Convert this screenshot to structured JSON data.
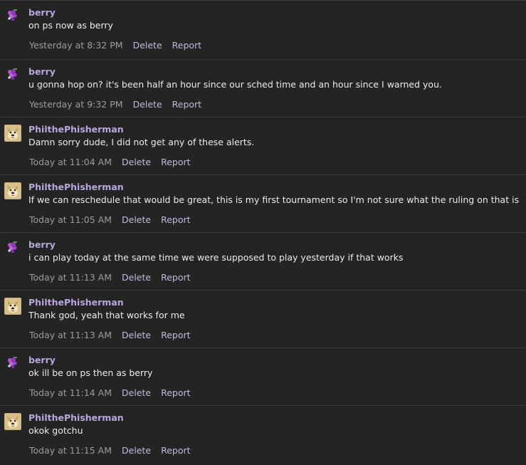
{
  "labels": {
    "delete": "Delete",
    "report": "Report"
  },
  "messages": [
    {
      "author": "berry",
      "avatar": "berry-avatar-icon",
      "text": "on ps now as berry",
      "time": "Yesterday at 8:32 PM"
    },
    {
      "author": "berry",
      "avatar": "berry-avatar-icon",
      "text": "u gonna hop on? it's been half an hour since our sched time and an hour since I warned you.",
      "time": "Yesterday at 9:32 PM"
    },
    {
      "author": "PhilthePhisherman",
      "avatar": "doge-avatar-icon",
      "text": "Damn sorry dude, I did not get any of these alerts.",
      "time": "Today at 11:04 AM"
    },
    {
      "author": "PhilthePhisherman",
      "avatar": "doge-avatar-icon",
      "text": "If we can reschedule that would be great, this is my first tournament so I'm not sure what the ruling on that is",
      "time": "Today at 11:05 AM"
    },
    {
      "author": "berry",
      "avatar": "berry-avatar-icon",
      "text": "i can play today at the same time we were supposed to play yesterday if that works",
      "time": "Today at 11:13 AM"
    },
    {
      "author": "PhilthePhisherman",
      "avatar": "doge-avatar-icon",
      "text": "Thank god, yeah that works for me",
      "time": "Today at 11:13 AM"
    },
    {
      "author": "berry",
      "avatar": "berry-avatar-icon",
      "text": "ok ill be on ps then as berry",
      "time": "Today at 11:14 AM"
    },
    {
      "author": "PhilthePhisherman",
      "avatar": "doge-avatar-icon",
      "text": "okok gotchu",
      "time": "Today at 11:15 AM"
    }
  ]
}
